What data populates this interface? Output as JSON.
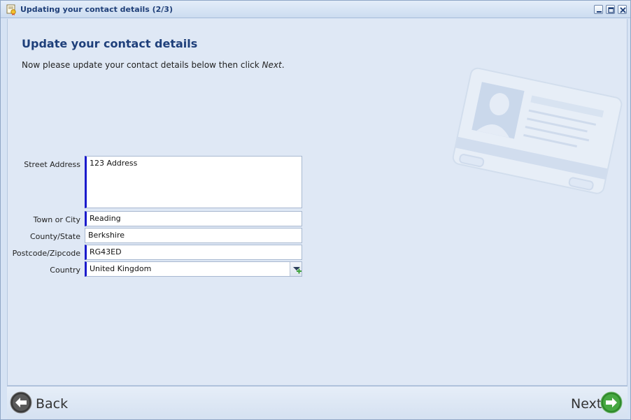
{
  "window": {
    "title": "Updating your contact details (2/3)"
  },
  "page": {
    "title": "Update your contact details",
    "instruction_prefix": "Now please update your contact details below then click ",
    "instruction_emphasis": "Next",
    "instruction_suffix": "."
  },
  "form": {
    "street_address": {
      "label": "Street Address",
      "value": "123 Address"
    },
    "town": {
      "label": "Town or City",
      "value": "Reading"
    },
    "county": {
      "label": "County/State",
      "value": "Berkshire"
    },
    "postcode": {
      "label": "Postcode/Zipcode",
      "value": "RG43ED"
    },
    "country": {
      "label": "Country",
      "value": "United Kingdom"
    }
  },
  "footer": {
    "back_label": "Back",
    "next_label": "Next"
  },
  "colors": {
    "accent": "#1e3f7a",
    "required_marker": "#1b1bcc",
    "next_green": "#3ea23a",
    "back_gray": "#4a4a4a"
  },
  "icons": [
    "certificate-icon",
    "minimize-icon",
    "maximize-icon",
    "close-icon",
    "dropdown-add-icon",
    "back-arrow-icon",
    "next-arrow-icon",
    "contact-card-illustration"
  ]
}
